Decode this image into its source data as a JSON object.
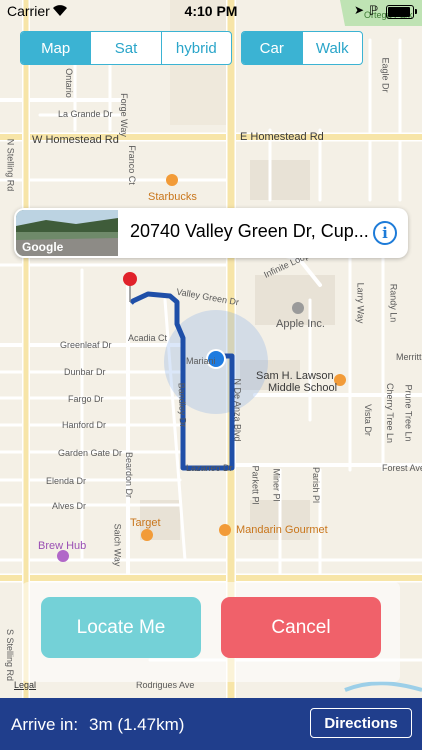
{
  "status_bar": {
    "carrier": "Carrier",
    "time": "4:10 PM"
  },
  "map_type": {
    "options": [
      "Map",
      "Sat",
      "hybrid"
    ],
    "selected": "Map"
  },
  "transport": {
    "options": [
      "Car",
      "Walk"
    ],
    "selected": "Car"
  },
  "callout": {
    "address": "20740 Valley Green Dr, Cup...",
    "thumb_label": "Google"
  },
  "map_labels": {
    "ortega_park": "Ortega Park",
    "w_homestead": "W Homestead Rd",
    "e_homestead": "E Homestead Rd",
    "la_grande": "La Grande Dr",
    "ontario": "Ontario",
    "forge_way": "Forge Way",
    "franco_ct": "Franco Ct",
    "n_stelling": "N Stelling Rd",
    "s_stelling": "S Stelling Rd",
    "starbucks": "Starbucks",
    "valley_green": "Valley Green Dr",
    "acadia_ct": "Acadia Ct",
    "greenleaf": "Greenleaf Dr",
    "dunbar": "Dunbar Dr",
    "fargo": "Fargo Dr",
    "hanford": "Hanford Dr",
    "garden_gate": "Garden Gate Dr",
    "elenda": "Elenda Dr",
    "alves": "Alves Dr",
    "target": "Target",
    "brew_hub": "Brew Hub",
    "mandarin": "Mandarin Gourmet",
    "apple": "Apple Inc.",
    "lawson_1": "Sam H. Lawson",
    "lawson_2": "Middle School",
    "infinite_loop": "Infinite Loop",
    "mariani": "Mariani",
    "merritt": "Merritt",
    "forest_ave": "Forest Ave",
    "lazaneo": "Lazaneo Dr",
    "n_de_anza": "N De Anza Blvd",
    "bandley": "Bandley Dr",
    "saich": "Saich Way",
    "beardon": "Beardon Dr",
    "rodrigues": "Rodrigues Ave",
    "larry_way": "Larry Way",
    "randy_ln": "Randy Ln",
    "vista": "Vista Dr",
    "cherry_tree": "Cherry Tree Ln",
    "prune_tree": "Prune Tree Ln",
    "eagle": "Eagle Dr",
    "parish": "Parish Pl",
    "miner": "Miner Pl",
    "parkett": "Parkett Pl",
    "legal": "Legal"
  },
  "actions": {
    "locate": "Locate Me",
    "cancel": "Cancel"
  },
  "bottom_bar": {
    "eta_label": "Arrive in:",
    "eta_value": "3m (1.47km)",
    "directions": "Directions"
  },
  "colors": {
    "accent": "#3bb3d3",
    "locate": "#74d1d7",
    "cancel": "#f0616a",
    "bar": "#203e8c",
    "route": "#1f4fa8"
  }
}
